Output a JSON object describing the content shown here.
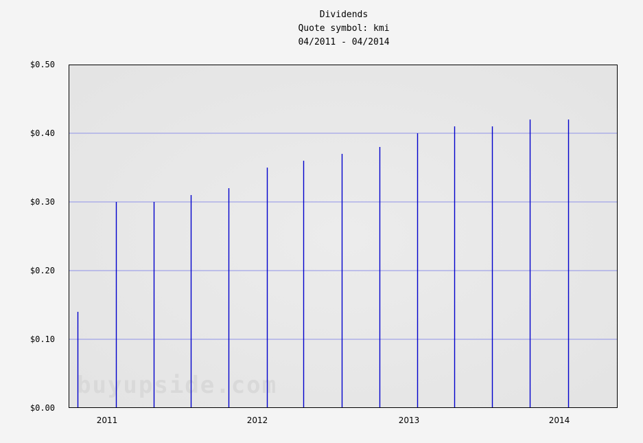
{
  "chart_data": {
    "type": "bar",
    "title": "Dividends",
    "subtitle": "Quote symbol: kmi",
    "date_range": "04/2011 - 04/2014",
    "xlabel": "",
    "ylabel": "",
    "ylim": [
      0,
      0.5
    ],
    "y_ticks": [
      "$0.00",
      "$0.10",
      "$0.20",
      "$0.30",
      "$0.40",
      "$0.50"
    ],
    "x_ticks": [
      "2011",
      "2012",
      "2013",
      "2014"
    ],
    "grid": true,
    "legend": "none",
    "watermark": "buyupside.com",
    "colors": {
      "bar": "#0000cc",
      "grid": "#8f92e8",
      "plot_background": "#e3e3e3",
      "page_background": "#f4f4f4"
    },
    "x": [
      "2010-10-29",
      "2011-01-31",
      "2011-05-02",
      "2011-08-01",
      "2011-10-31",
      "2012-02-01",
      "2012-04-30",
      "2012-07-31",
      "2012-10-31",
      "2013-01-31",
      "2013-04-30",
      "2013-07-31",
      "2013-10-31",
      "2014-02-01"
    ],
    "values": [
      0.14,
      0.3,
      0.3,
      0.31,
      0.32,
      0.35,
      0.36,
      0.37,
      0.38,
      0.4,
      0.41,
      0.41,
      0.42,
      0.42
    ]
  }
}
